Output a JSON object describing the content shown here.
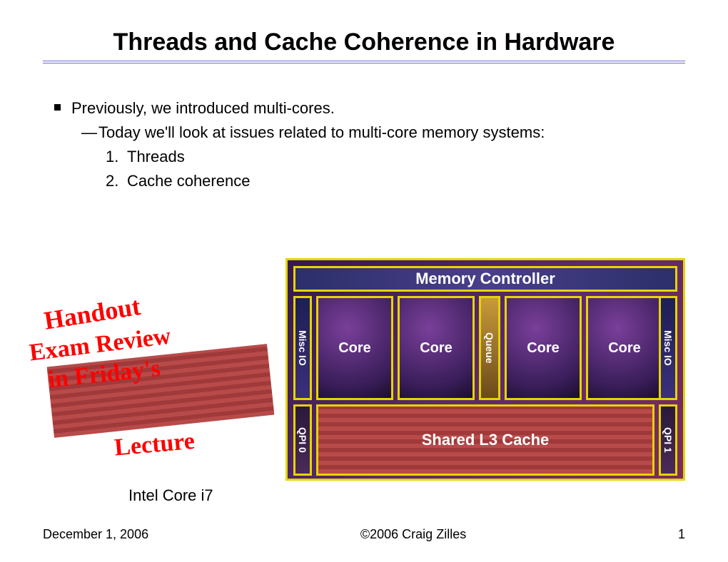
{
  "title": "Threads and Cache Coherence in Hardware",
  "bullets": {
    "prev": "Previously, we introduced multi-cores.",
    "today": "Today we'll look at issues related to multi-core memory systems:",
    "n1": "Threads",
    "n2": "Cache coherence"
  },
  "handwriting": {
    "l1": "Handout",
    "l2": "Exam Review",
    "l3": "in Friday's",
    "l4": "Lecture"
  },
  "die": {
    "caption": "Intel Core i7",
    "mem": "Memory Controller",
    "misc0": "Misc IO",
    "misc1": "Misc IO",
    "core": "Core",
    "queue": "Queue",
    "qpi0": "QPI 0",
    "qpi1": "QPI 1",
    "l3": "Shared L3 Cache"
  },
  "footer": {
    "date": "December 1, 2006",
    "copyright": "©2006 Craig Zilles",
    "page": "1"
  }
}
